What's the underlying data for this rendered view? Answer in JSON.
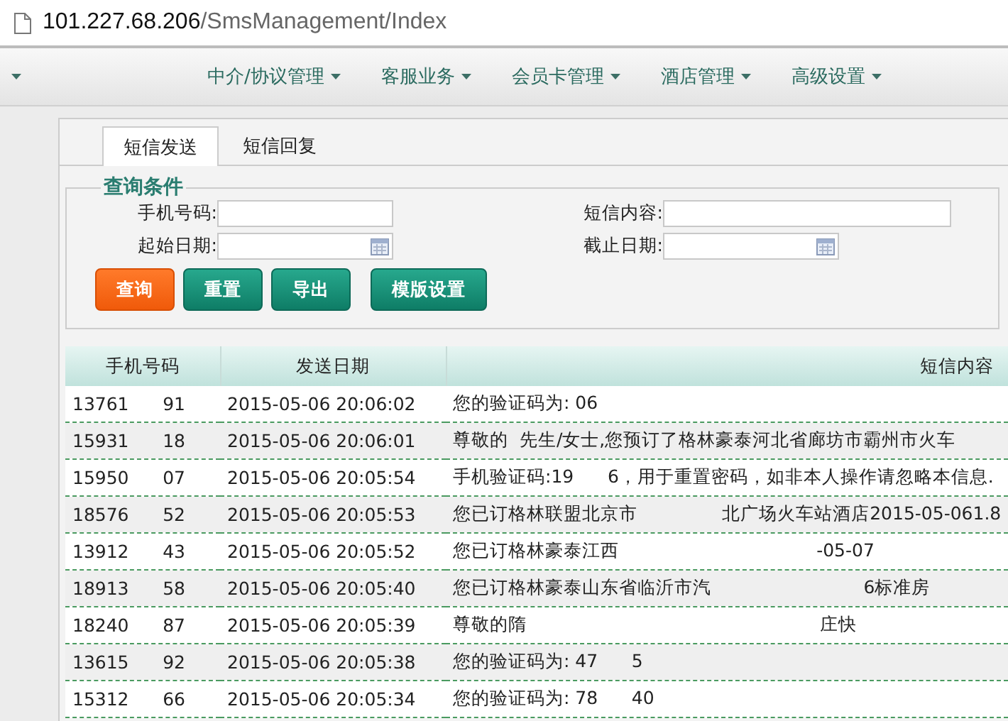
{
  "address_bar": {
    "url_host": "101.227.68.206",
    "url_path": "/SmsManagement/Index"
  },
  "nav": {
    "menus": [
      {
        "label": "中介/协议管理"
      },
      {
        "label": "客服业务"
      },
      {
        "label": "会员卡管理"
      },
      {
        "label": "酒店管理"
      },
      {
        "label": "高级设置"
      }
    ]
  },
  "tabs": [
    {
      "label": "短信发送",
      "selected": true
    },
    {
      "label": "短信回复",
      "selected": false
    }
  ],
  "query": {
    "title": "查询条件",
    "fields": [
      {
        "label": "手机号码:",
        "kind": "text"
      },
      {
        "label": "短信内容:",
        "kind": "text"
      },
      {
        "label": "起始日期:",
        "kind": "date"
      },
      {
        "label": "截止日期:",
        "kind": "date"
      }
    ],
    "buttons": [
      {
        "label": "查询",
        "kind": "primary"
      },
      {
        "label": "重置",
        "kind": "secondary"
      },
      {
        "label": "导出",
        "kind": "secondary"
      },
      {
        "label": "模版设置",
        "kind": "secondary"
      }
    ]
  },
  "table": {
    "columns": [
      "手机号码",
      "发送日期",
      "短信内容"
    ],
    "rows": [
      {
        "phone": "13761      91",
        "date": "2015-05-06 20:06:02",
        "content": "您的验证码为: 06"
      },
      {
        "phone": "15931      18",
        "date": "2015-05-06 20:06:01",
        "content": "尊敬的  先生/女士,您预订了格林豪泰河北省廊坊市霸州市火车"
      },
      {
        "phone": "15950      07",
        "date": "2015-05-06 20:05:54",
        "content": "手机验证码:19      6，用于重置密码，如非本人操作请忽略本信息."
      },
      {
        "phone": "18576      52",
        "date": "2015-05-06 20:05:53",
        "content": "您已订格林联盟北京市               北广场火车站酒店2015-05-061.8"
      },
      {
        "phone": "13912      43",
        "date": "2015-05-06 20:05:52",
        "content": "您已订格林豪泰江西                                   -05-07"
      },
      {
        "phone": "18913      58",
        "date": "2015-05-06 20:05:40",
        "content": "您已订格林豪泰山东省临沂市汽                           6标准房"
      },
      {
        "phone": "18240      87",
        "date": "2015-05-06 20:05:39",
        "content": "尊敬的隋                                                    庄快"
      },
      {
        "phone": "13615      92",
        "date": "2015-05-06 20:05:38",
        "content": "您的验证码为: 47      5"
      },
      {
        "phone": "15312      66",
        "date": "2015-05-06 20:05:34",
        "content": "您的验证码为: 78      40"
      }
    ]
  }
}
